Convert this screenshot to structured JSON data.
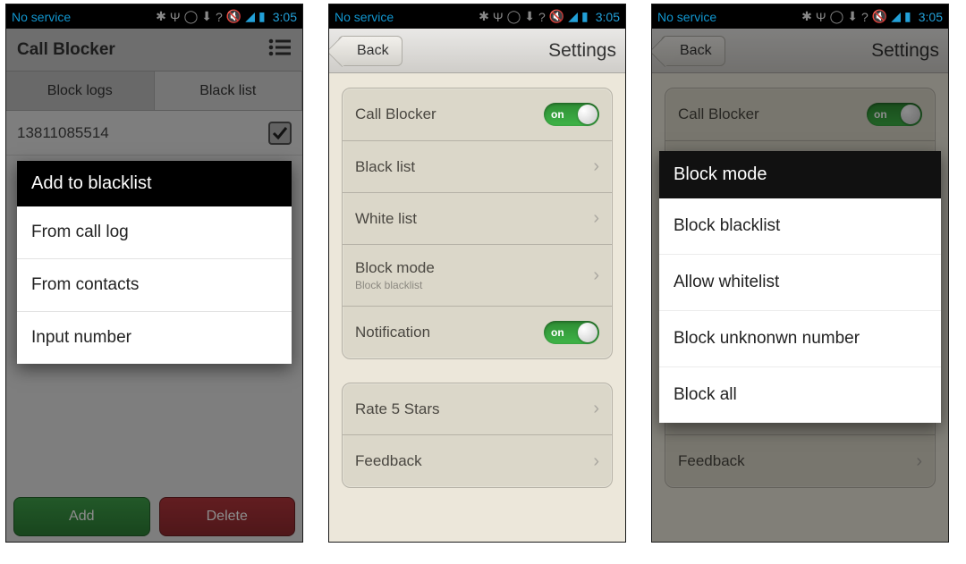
{
  "statusbar": {
    "service": "No service",
    "time": "3:05"
  },
  "screen1": {
    "title": "Call Blocker",
    "tabs": {
      "block_logs": "Block logs",
      "black_list": "Black list"
    },
    "numbers": [
      "13811085514"
    ],
    "buttons": {
      "add": "Add",
      "delete": "Delete"
    },
    "dialog": {
      "title": "Add to blacklist",
      "options": [
        "From call log",
        "From contacts",
        "Input number"
      ]
    }
  },
  "settings": {
    "back": "Back",
    "title": "Settings",
    "rows": {
      "call_blocker": "Call Blocker",
      "black_list": "Black list",
      "white_list": "White list",
      "block_mode": "Block mode",
      "block_mode_sub": "Block blacklist",
      "notification": "Notification",
      "rate": "Rate 5 Stars",
      "feedback": "Feedback"
    },
    "toggle_label": "on"
  },
  "block_mode_dialog": {
    "title": "Block mode",
    "options": [
      "Block blacklist",
      "Allow whitelist",
      "Block unknonwn number",
      "Block all"
    ]
  }
}
